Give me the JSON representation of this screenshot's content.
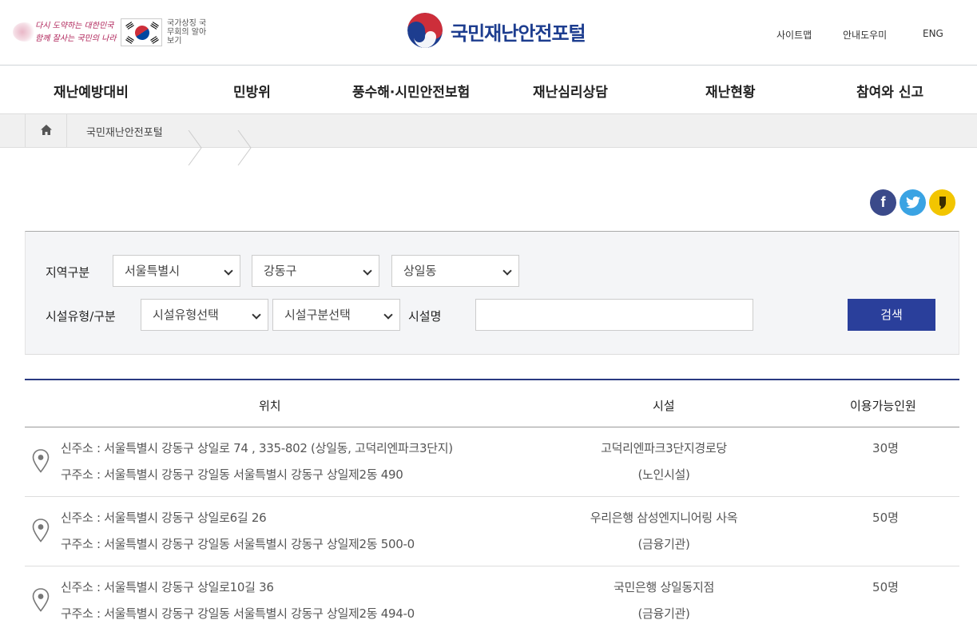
{
  "header": {
    "slogan_line1": "다시 도약하는 대한민국",
    "slogan_line2": "함께 잘사는 국민의 나라",
    "symbol_link": "국가상징 국무회의 알아보기",
    "site_title": "국민재난안전포털",
    "util_links": [
      "사이트맵",
      "안내도우미",
      "ENG"
    ]
  },
  "gnb": [
    "재난예방대비",
    "민방위",
    "풍수해·시민안전보험",
    "재난심리상담",
    "재난현황",
    "참여와 신고"
  ],
  "breadcrumb": {
    "current": "국민재난안전포털"
  },
  "search": {
    "region_label": "지역구분",
    "region_sido": "서울특별시",
    "region_sigungu": "강동구",
    "region_dong": "상일동",
    "facility_label": "시설유형/구분",
    "facility_type": "시설유형선택",
    "facility_class": "시설구분선택",
    "name_label": "시설명",
    "name_value": "",
    "button_label": "검색"
  },
  "table": {
    "headers": [
      "위치",
      "시설",
      "이용가능인원"
    ],
    "rows": [
      {
        "new_addr": "신주소 : 서울특별시 강동구 상일로 74 , 335-802 (상일동, 고덕리엔파크3단지)",
        "old_addr": "구주소 : 서울특별시 강동구 강일동 서울특별시 강동구 상일제2동 490",
        "facility": "고덕리엔파크3단지경로당",
        "facility_type": "(노인시설)",
        "capacity": "30명"
      },
      {
        "new_addr": "신주소 : 서울특별시 강동구 상일로6길 26",
        "old_addr": "구주소 : 서울특별시 강동구 강일동 서울특별시 강동구 상일제2동 500-0",
        "facility": "우리은행 삼성엔지니어링 사옥",
        "facility_type": "(금융기관)",
        "capacity": "50명"
      },
      {
        "new_addr": "신주소 : 서울특별시 강동구 상일로10길 36",
        "old_addr": "구주소 : 서울특별시 강동구 강일동 서울특별시 강동구 상일제2동 494-0",
        "facility": "국민은행 상일동지점",
        "facility_type": "(금융기관)",
        "capacity": "50명"
      }
    ]
  },
  "colors": {
    "primary": "#2a3f9b",
    "logo_blue": "#1d3d8f",
    "logo_red": "#cd2e3a",
    "facebook": "#3b4a8a",
    "twitter": "#3aa3e3",
    "kakao": "#f2c500"
  },
  "icons": [
    "home-icon",
    "facebook-icon",
    "twitter-icon",
    "kakaostory-icon",
    "location-pin-icon",
    "chevron-down-icon"
  ]
}
